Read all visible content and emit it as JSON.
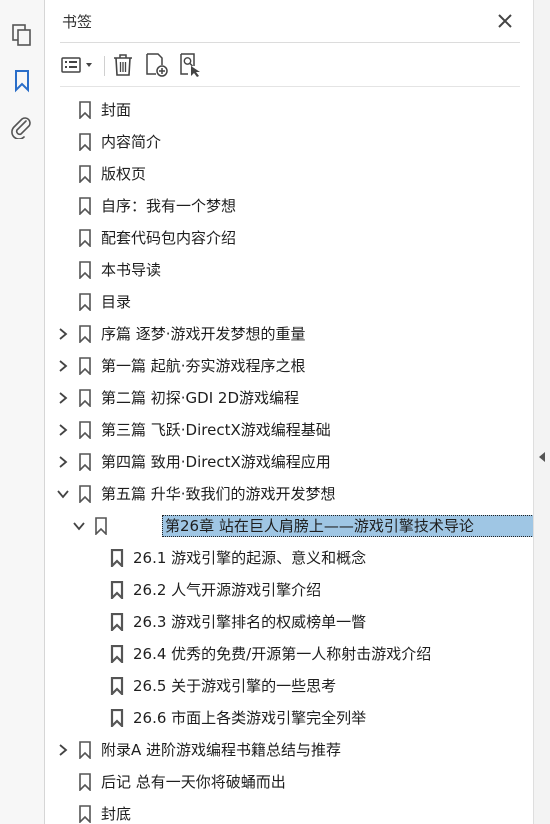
{
  "panel": {
    "title": "书签"
  },
  "leftbar": {
    "icons": [
      "pages-icon",
      "bookmark-icon",
      "attachment-icon"
    ]
  },
  "toolbar": {
    "icons": [
      "options-menu-icon",
      "delete-icon",
      "new-bookmark-icon",
      "new-bookmark-from-structure-icon"
    ]
  },
  "colors": {
    "selected_bg": "#9fc6e4",
    "active_icon": "#2a6ec9",
    "icon_gray": "#555555"
  },
  "bookmarks": [
    {
      "label": "封面",
      "level": 0,
      "expander": "none"
    },
    {
      "label": "内容简介",
      "level": 0,
      "expander": "none"
    },
    {
      "label": "版权页",
      "level": 0,
      "expander": "none"
    },
    {
      "label": "自序：我有一个梦想",
      "level": 0,
      "expander": "none"
    },
    {
      "label": "配套代码包内容介绍",
      "level": 0,
      "expander": "none"
    },
    {
      "label": "本书导读",
      "level": 0,
      "expander": "none"
    },
    {
      "label": "目录",
      "level": 0,
      "expander": "none"
    },
    {
      "label": "序篇 逐梦·游戏开发梦想的重量",
      "level": 0,
      "expander": "collapsed"
    },
    {
      "label": "第一篇 起航·夯实游戏程序之根",
      "level": 0,
      "expander": "collapsed"
    },
    {
      "label": "第二篇 初探·GDI 2D游戏编程",
      "level": 0,
      "expander": "collapsed"
    },
    {
      "label": "第三篇 飞跃·DirectX游戏编程基础",
      "level": 0,
      "expander": "collapsed"
    },
    {
      "label": "第四篇 致用·DirectX游戏编程应用",
      "level": 0,
      "expander": "collapsed"
    },
    {
      "label": "第五篇 升华·致我们的游戏开发梦想",
      "level": 0,
      "expander": "expanded"
    },
    {
      "label": "第26章 站在巨人肩膀上——游戏引擎技术导论",
      "level": 1,
      "expander": "expanded",
      "selected": true
    },
    {
      "label": "26.1 游戏引擎的起源、意义和概念",
      "level": 2,
      "expander": "none"
    },
    {
      "label": "26.2 人气开源游戏引擎介绍",
      "level": 2,
      "expander": "none"
    },
    {
      "label": "26.3 游戏引擎排名的权威榜单一瞥",
      "level": 2,
      "expander": "none"
    },
    {
      "label": "26.4 优秀的免费/开源第一人称射击游戏介绍",
      "level": 2,
      "expander": "none"
    },
    {
      "label": "26.5 关于游戏引擎的一些思考",
      "level": 2,
      "expander": "none"
    },
    {
      "label": "26.6 市面上各类游戏引擎完全列举",
      "level": 2,
      "expander": "none"
    },
    {
      "label": "附录A 进阶游戏编程书籍总结与推荐",
      "level": 0,
      "expander": "collapsed"
    },
    {
      "label": "后记 总有一天你将破蛹而出",
      "level": 0,
      "expander": "none"
    },
    {
      "label": "封底",
      "level": 0,
      "expander": "none"
    }
  ]
}
